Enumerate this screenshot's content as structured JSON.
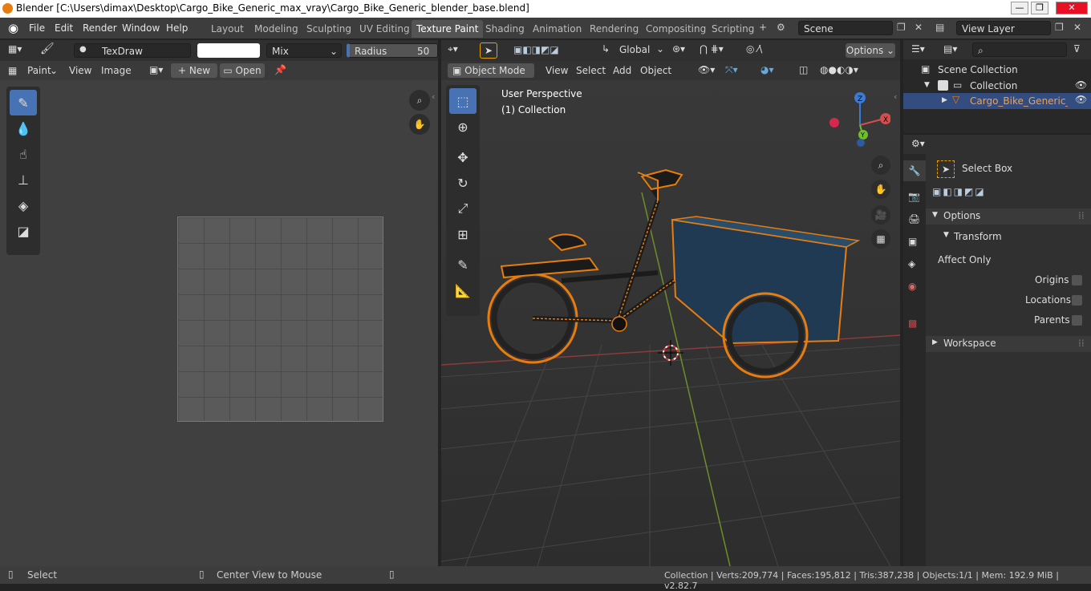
{
  "window": {
    "title": "Blender [C:\\Users\\dimax\\Desktop\\Cargo_Bike_Generic_max_vray\\Cargo_Bike_Generic_blender_base.blend]",
    "minimize": "—",
    "maximize": "❐",
    "close": "✕"
  },
  "menu": [
    "File",
    "Edit",
    "Render",
    "Window",
    "Help"
  ],
  "workspaces": [
    "Layout",
    "Modeling",
    "Sculpting",
    "UV Editing",
    "Texture Paint",
    "Shading",
    "Animation",
    "Rendering",
    "Compositing",
    "Scripting"
  ],
  "scene": {
    "label": "Scene",
    "view_layer": "View Layer"
  },
  "paint_header": {
    "brush": "TexDraw",
    "blend": "Mix",
    "radius_label": "Radius",
    "radius_value": "50 px",
    "mode": "Paint",
    "view": "View",
    "image": "Image",
    "new": "New",
    "open": "Open"
  },
  "viewport_header": {
    "orientation": "Global",
    "options": "Options",
    "mode": "Object Mode",
    "view": "View",
    "select": "Select",
    "add": "Add",
    "object": "Object"
  },
  "viewport": {
    "perspective": "User Perspective",
    "collection": "(1) Collection"
  },
  "gizmo": {
    "x": "X",
    "y": "Y",
    "z": "Z"
  },
  "outliner": {
    "scene_collection": "Scene Collection",
    "collection": "Collection",
    "object": "Cargo_Bike_Generic_obj"
  },
  "properties": {
    "tool": "Select Box",
    "options": "Options",
    "transform": "Transform",
    "affect_only": "Affect Only",
    "origins": "Origins",
    "locations": "Locations",
    "parents": "Parents",
    "workspace": "Workspace"
  },
  "status": {
    "select": "Select",
    "center": "Center View to Mouse",
    "stats": "Collection | Verts:209,774 | Faces:195,812 | Tris:387,238 | Objects:1/1 | Mem: 192.9 MiB | v2.82.7"
  },
  "colors": {
    "accent": "#4772b3",
    "selection": "#e87d0d",
    "box": "#1f3a52"
  }
}
